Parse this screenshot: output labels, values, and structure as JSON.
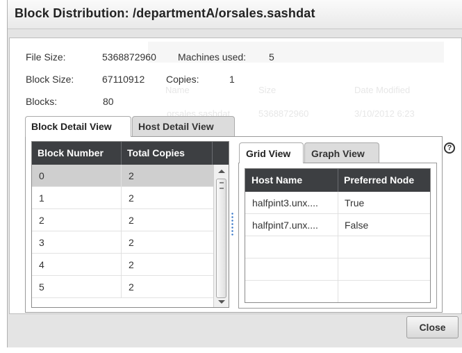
{
  "dialog": {
    "title": "Block Distribution: /departmentA/orsales.sashdat"
  },
  "info": {
    "file_size_label": "File Size:",
    "file_size_value": "5368872960",
    "machines_label": "Machines used:",
    "machines_value": "5",
    "block_size_label": "Block Size:",
    "block_size_value": "67110912",
    "copies_label": "Copies:",
    "copies_value": "1",
    "blocks_label": "Blocks:",
    "blocks_value": "80"
  },
  "background_ghost": {
    "name_header": "Name",
    "size_header": "Size",
    "modified_header": "Date Modified",
    "row_name": "orsales.sashdat",
    "row_size": "5368872960",
    "row_date": "3/10/2012 6:23"
  },
  "outer_tabs": {
    "block_detail": "Block Detail View",
    "host_detail": "Host Detail View"
  },
  "block_table": {
    "headers": [
      "Block Number",
      "Total Copies"
    ],
    "rows": [
      {
        "block": "0",
        "copies": "2"
      },
      {
        "block": "1",
        "copies": "2"
      },
      {
        "block": "2",
        "copies": "2"
      },
      {
        "block": "3",
        "copies": "2"
      },
      {
        "block": "4",
        "copies": "2"
      },
      {
        "block": "5",
        "copies": "2"
      }
    ]
  },
  "inner_tabs": {
    "grid": "Grid View",
    "graph": "Graph View"
  },
  "help": {
    "glyph": "?"
  },
  "host_table": {
    "headers": [
      "Host Name",
      "Preferred Node"
    ],
    "rows": [
      {
        "host": "halfpint3.unx....",
        "preferred": "True"
      },
      {
        "host": "halfpint7.unx....",
        "preferred": "False"
      }
    ]
  },
  "footer": {
    "close_label": "Close"
  }
}
